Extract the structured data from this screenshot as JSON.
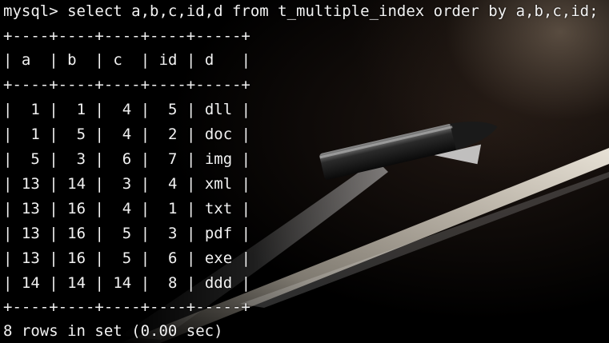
{
  "terminal": {
    "prompt": "mysql> ",
    "command": "select a,b,c,id,d from t_multiple_index order by a,b,c,id;"
  },
  "table": {
    "columns": [
      "a",
      "b",
      "c",
      "id",
      "d"
    ],
    "rows": [
      [
        "1",
        "1",
        "4",
        "5",
        "dll"
      ],
      [
        "1",
        "5",
        "4",
        "2",
        "doc"
      ],
      [
        "5",
        "3",
        "6",
        "7",
        "img"
      ],
      [
        "13",
        "14",
        "3",
        "4",
        "xml"
      ],
      [
        "13",
        "16",
        "4",
        "1",
        "txt"
      ],
      [
        "13",
        "16",
        "5",
        "3",
        "pdf"
      ],
      [
        "13",
        "16",
        "5",
        "6",
        "exe"
      ],
      [
        "14",
        "14",
        "14",
        "8",
        "ddd"
      ]
    ]
  },
  "result_status": "8 rows in set (0.00 sec)",
  "colors": {
    "text": "#f2f2f2",
    "background": "#000000"
  }
}
